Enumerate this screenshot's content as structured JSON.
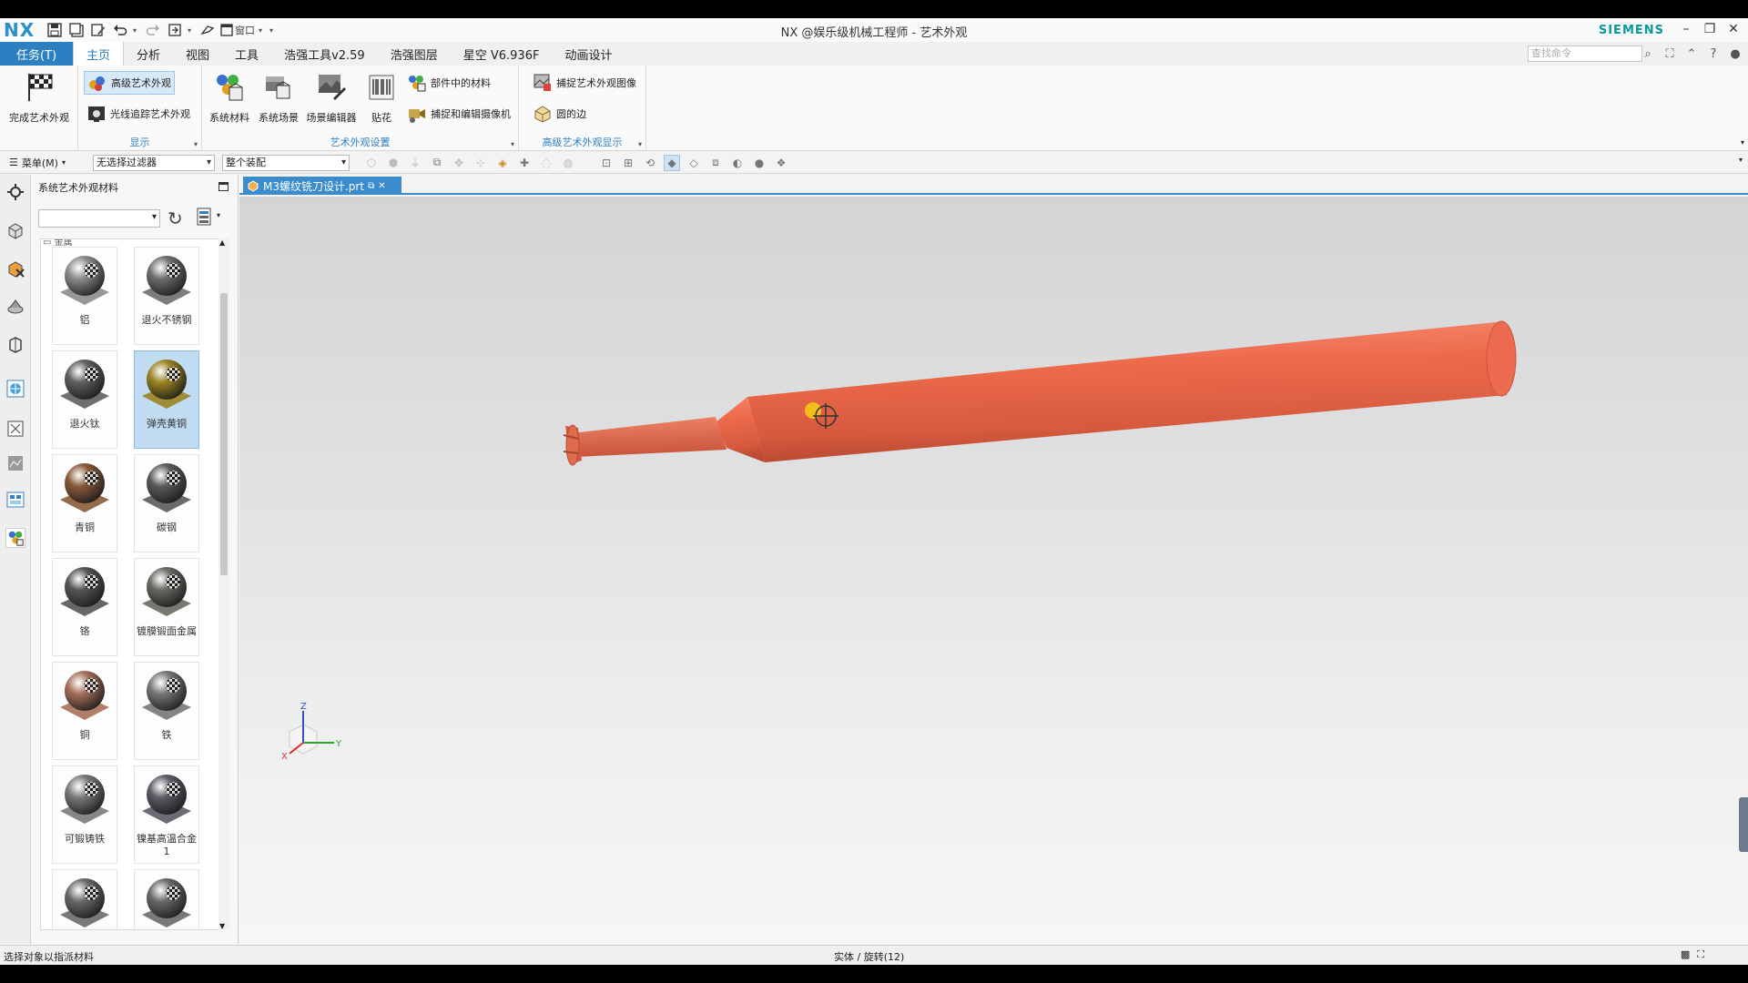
{
  "app": {
    "logo": "NX",
    "title": "NX @娱乐级机械工程师 - 艺术外观",
    "brand": "SIEMENS",
    "window_menu_label": "窗口"
  },
  "menu_tabs": {
    "task": "任务(T)",
    "tabs": [
      "主页",
      "分析",
      "视图",
      "工具",
      "浩强工具v2.59",
      "浩强图层",
      "星空 V6.936F",
      "动画设计"
    ],
    "active": "主页",
    "command_search_placeholder": "查找命令"
  },
  "ribbon": {
    "finish_label": "完成艺术外观",
    "display_group": {
      "label": "显示",
      "advanced_studio": "高级艺术外观",
      "ray_traced": "光线追踪艺术外观"
    },
    "settings_group": {
      "label": "艺术外观设置",
      "system_materials": "系统材料",
      "system_scenes": "系统场景",
      "scene_editor": "场景编辑器",
      "decal": "贴花",
      "materials_in_part": "部件中的材料",
      "capture_camera": "捕捉和编辑摄像机"
    },
    "advanced_group": {
      "label": "高级艺术外观显示",
      "capture_image": "捕捉艺术外观图像",
      "rounded_edges": "圆的边"
    }
  },
  "toolbar": {
    "menu_label": "菜单(M)",
    "selection_filter": "无选择过滤器",
    "assembly_scope": "整个装配"
  },
  "material_panel": {
    "title": "系统艺术外观材料",
    "category_partial": "金属",
    "items": [
      {
        "name": "铝",
        "color": "#8c8c8c"
      },
      {
        "name": "退火不锈钢",
        "color": "#6e6e6e"
      },
      {
        "name": "退火钛",
        "color": "#5f5f5f"
      },
      {
        "name": "弹壳黄铜",
        "color": "#9a8420"
      },
      {
        "name": "青铜",
        "color": "#8a5a3a"
      },
      {
        "name": "碳钢",
        "color": "#5a5a5a"
      },
      {
        "name": "铬",
        "color": "#555555"
      },
      {
        "name": "镀膜锻面金属",
        "color": "#6a6a62"
      },
      {
        "name": "铜",
        "color": "#a8705a"
      },
      {
        "name": "铁",
        "color": "#777777"
      },
      {
        "name": "可锻铸铁",
        "color": "#7a7a7a"
      },
      {
        "name": "镍基高温合金 1",
        "color": "#5e5a66"
      },
      {
        "name": "",
        "color": "#6a6a6a"
      },
      {
        "name": "",
        "color": "#6a6a6a"
      }
    ],
    "selected": "弹壳黄铜"
  },
  "document": {
    "tab_name": "M3螺纹铣刀设计.prt",
    "part_color": "#ec6a4e"
  },
  "triad": {
    "x": "X",
    "y": "Y",
    "z": "Z"
  },
  "status": {
    "prompt": "选择对象以指派材料",
    "selection": "实体 / 旋转(12)"
  }
}
